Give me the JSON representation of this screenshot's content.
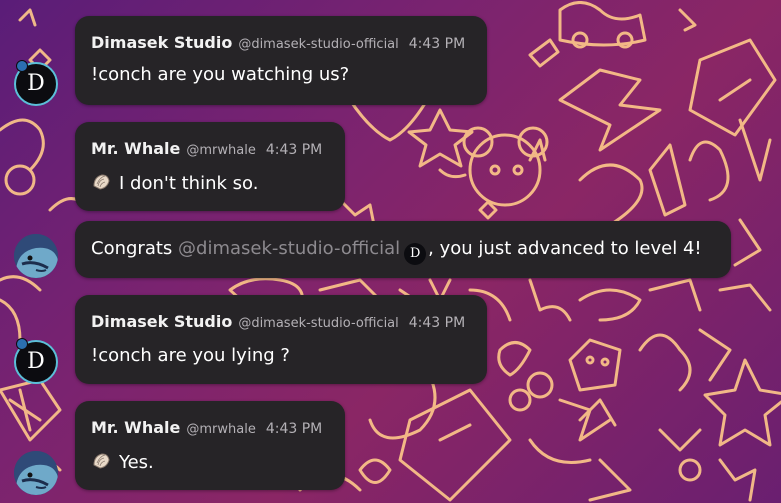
{
  "messages": [
    {
      "author": "Dimasek Studio",
      "handle": "@dimasek-studio-official",
      "time": "4:43 PM",
      "text": "!conch are you watching us?"
    },
    {
      "author": "Mr. Whale",
      "handle": "@mrwhale",
      "time": "4:43 PM",
      "text": "I don't think so."
    },
    {
      "text_before": "Congrats ",
      "mention": "@dimasek-studio-official",
      "text_after": ", you just advanced to level 4!"
    },
    {
      "author": "Dimasek Studio",
      "handle": "@dimasek-studio-official",
      "time": "4:43 PM",
      "text": "!conch are you lying ?"
    },
    {
      "author": "Mr. Whale",
      "handle": "@mrwhale",
      "time": "4:43 PM",
      "text": "Yes."
    }
  ],
  "avatars": {
    "dimasek_letter": "D"
  },
  "colors": {
    "bubble": "#262427",
    "avatar_ring": "#5bbfd8",
    "doodle_glow": "#ffd27a",
    "mention": "#8d8a8f"
  }
}
